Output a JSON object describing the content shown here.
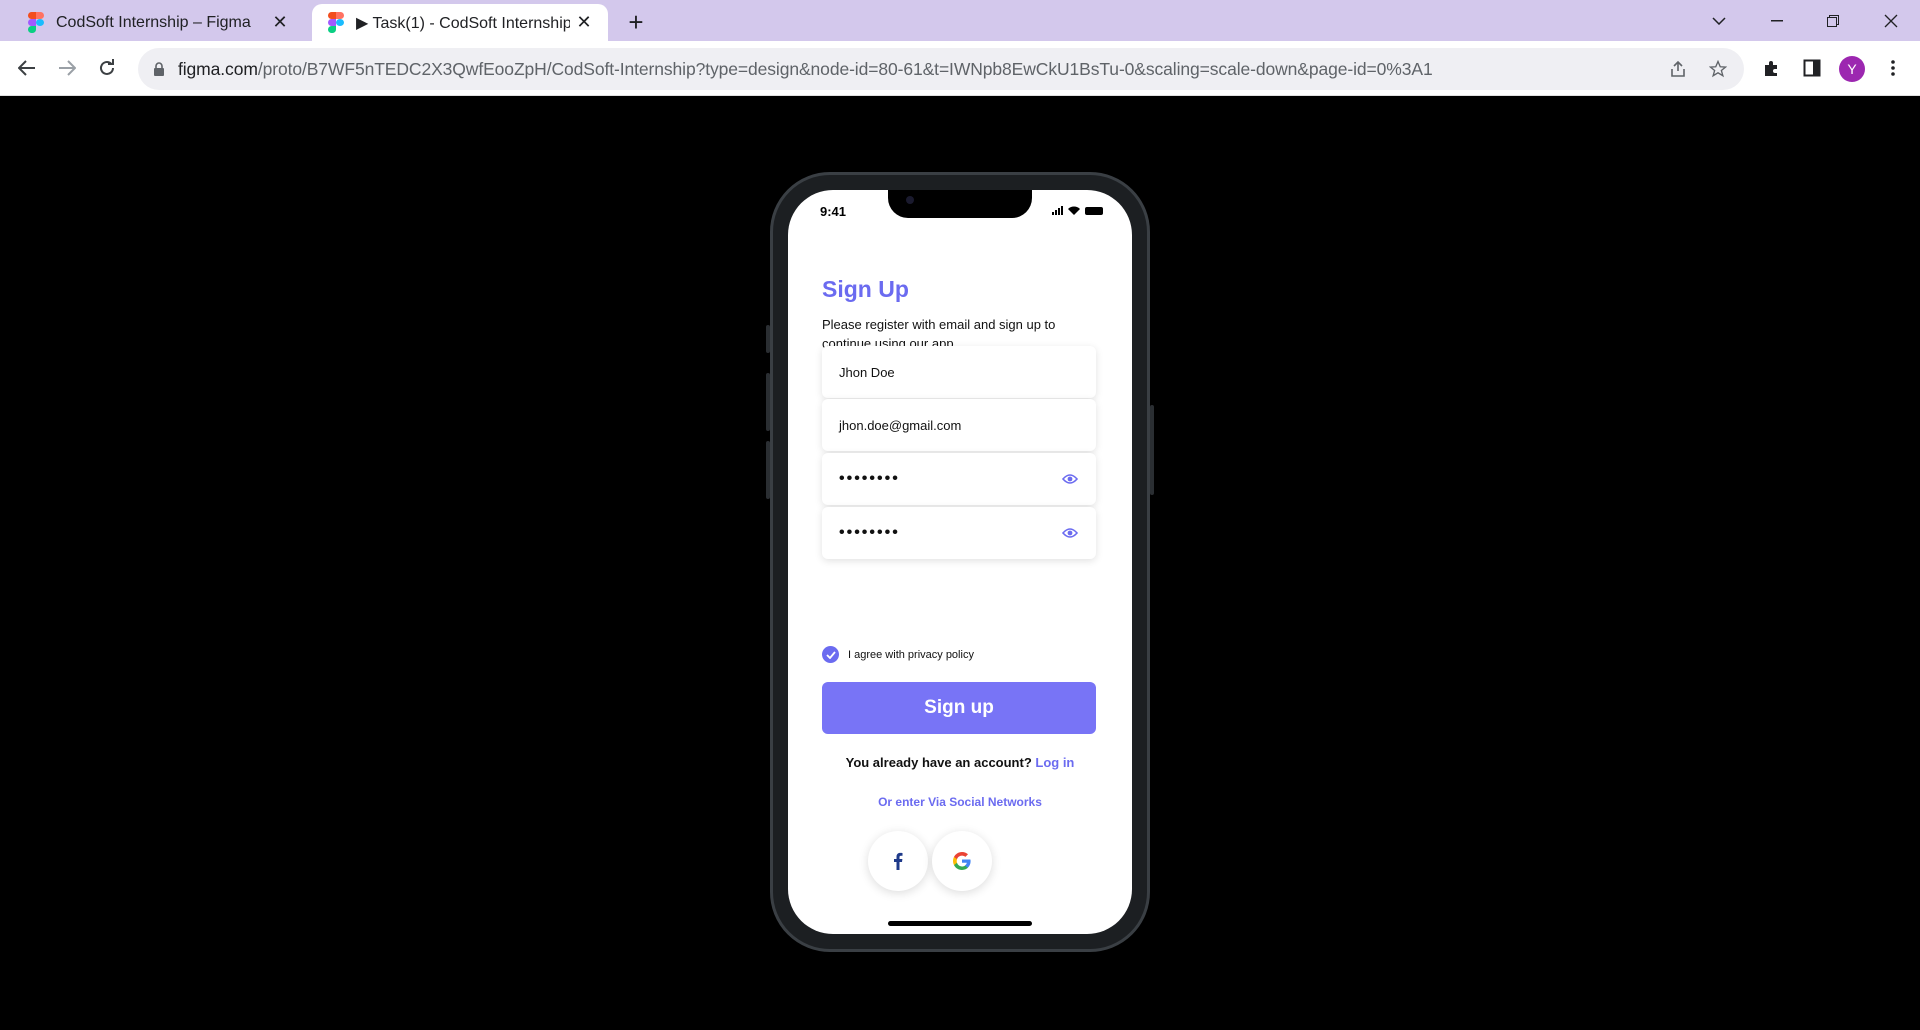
{
  "browser": {
    "tabs": [
      {
        "title": "CodSoft Internship – Figma",
        "active": false
      },
      {
        "title": "▶ Task(1) - CodSoft Internship",
        "active": true
      }
    ],
    "url_domain": "figma.com",
    "url_path": "/proto/B7WF5nTEDC2X3QwfEooZpH/CodSoft-Internship?type=design&node-id=80-61&t=IWNpb8EwCkU1BsTu-0&scaling=scale-down&page-id=0%3A1",
    "profile_initial": "Y",
    "accent_color": "#d3c8ec"
  },
  "phone": {
    "status_time": "9:41",
    "screen": {
      "title": "Sign Up",
      "subtitle": "Please register with email and sign up to continue using our app.",
      "name_value": "Jhon Doe",
      "email_value": "jhon.doe@gmail.com",
      "password_value": "••••••••",
      "confirm_password_value": "••••••••",
      "agree_label": "I agree with privacy policy",
      "agree_checked": true,
      "signup_button": "Sign up",
      "have_account_text": "You already have an account?",
      "login_link": "Log in",
      "social_text": "Or enter Via Social Networks",
      "social_buttons": [
        "facebook-icon",
        "google-icon"
      ],
      "brand_color": "#7874f6"
    }
  }
}
